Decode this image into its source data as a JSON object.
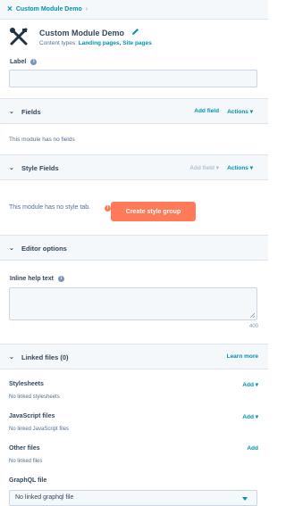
{
  "breadcrumb": {
    "label": "Custom Module Demo",
    "chevron": "›",
    "close_icon": "×"
  },
  "module": {
    "title": "Custom Module Demo",
    "content_types_prefix": "Content types:",
    "content_types_links": "Landing pages, Site pages",
    "icon": "wrench-screwdriver-icon"
  },
  "label_field": {
    "label": "Label",
    "value": ""
  },
  "fields_section": {
    "title": "Fields",
    "add_label": "Add field",
    "actions_label": "Actions",
    "empty": "This module has no fields"
  },
  "style_section": {
    "title": "Style Fields",
    "add_label": "Add field",
    "actions_label": "Actions",
    "empty": "This module has no style tab.",
    "button_label": "Create style group"
  },
  "editor_section": {
    "title": "Editor options"
  },
  "help_field": {
    "label": "Inline help text",
    "value": "",
    "char_count": "400"
  },
  "linked_section": {
    "title": "Linked files (0)",
    "learn_more": "Learn more",
    "groups": [
      {
        "title": "Stylesheets",
        "action": "Add",
        "empty": "No linked stylesheets"
      },
      {
        "title": "JavaScript files",
        "action": "Add",
        "empty": "No linked JavaScript files"
      },
      {
        "title": "Other files",
        "action": "Add",
        "empty": "No linked files"
      }
    ],
    "graphql": {
      "title": "GraphQL file",
      "selected": "No linked graphql file"
    }
  },
  "colors": {
    "accent": "#0091ae",
    "cta": "#ff7a59",
    "text": "#33475b",
    "panel": "#f5f8fa"
  }
}
